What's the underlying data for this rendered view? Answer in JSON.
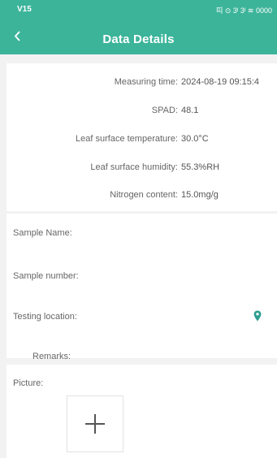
{
  "status_bar": {
    "time": "V15",
    "icons": "띠 ⊙ 3ᴵ 3ᴵ ≋ 0000"
  },
  "header": {
    "back_icon": "chevron-left-icon",
    "title": "Data Details"
  },
  "measurements": [
    {
      "label": "Measuring time:",
      "value": "2024-08-19 09:15:4"
    },
    {
      "label": "SPAD:",
      "value": "48.1"
    },
    {
      "label": "Leaf surface temperature:",
      "value": "30.0°C"
    },
    {
      "label": "Leaf surface humidity:",
      "value": "55.3%RH"
    },
    {
      "label": "Nitrogen content:",
      "value": "15.0mg/g"
    }
  ],
  "form": {
    "sample_name_label": "Sample Name:",
    "sample_number_label": "Sample number:",
    "testing_location_label": "Testing location:",
    "remarks_label": "Remarks:",
    "location_icon": "location-pin-icon"
  },
  "picture": {
    "label": "Picture:",
    "add_icon": "plus-icon"
  },
  "colors": {
    "header": "#3cb49a",
    "background": "#f2f2f2",
    "pin": "#2a9d8f"
  }
}
